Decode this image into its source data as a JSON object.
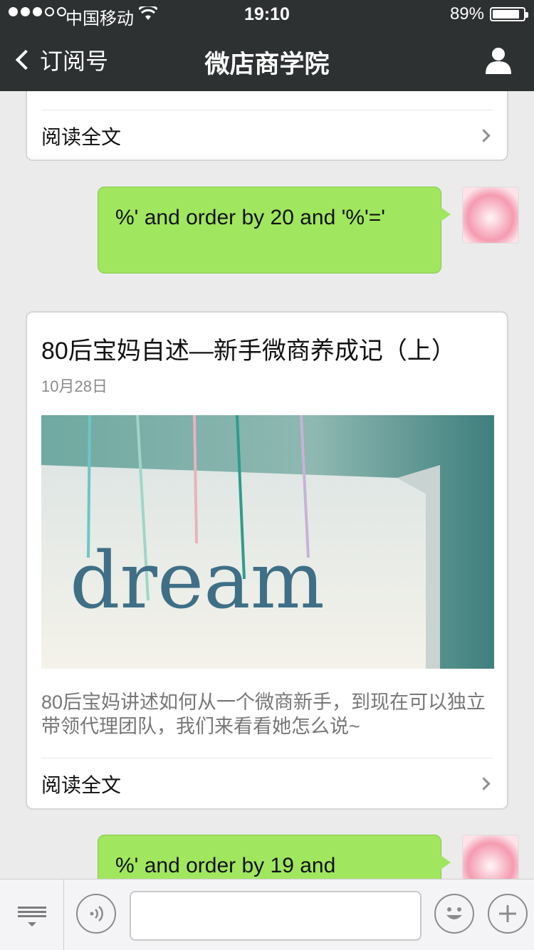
{
  "status": {
    "carrier": "中国移动",
    "time": "19:10",
    "battery": "89%",
    "battery_level": 0.89
  },
  "nav": {
    "back_label": "订阅号",
    "title": "微店商学院"
  },
  "top_card": {
    "read_more": "阅读全文"
  },
  "messages": [
    {
      "text": "%' and order by 20 and '%'='"
    },
    {
      "text": "%' and order by 19 and"
    }
  ],
  "article": {
    "title": "80后宝妈自述—新手微商养成记（上）",
    "date": "10月28日",
    "image_text": "dream",
    "description": "80后宝妈讲述如何从一个微商新手，到现在可以独立带领代理团队，我们来看看她怎么说~",
    "read_more": "阅读全文"
  },
  "toolbar": {
    "input_placeholder": ""
  },
  "colors": {
    "bubble": "#a0e65e",
    "nav_bg": "#2e3132",
    "background": "#ebebeb"
  },
  "icons": [
    "wifi-icon",
    "back-chevron-icon",
    "user-icon",
    "chevron-right-icon",
    "menu-icon",
    "voice-icon",
    "emoji-icon",
    "plus-icon"
  ]
}
